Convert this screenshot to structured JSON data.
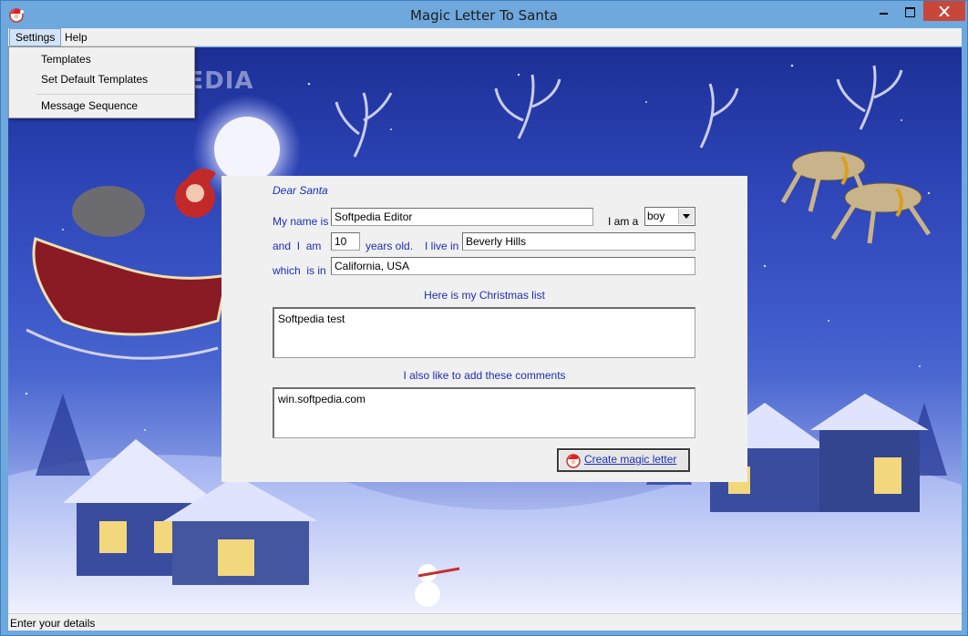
{
  "window": {
    "title": "Magic Letter To Santa",
    "accent": "#6ea8dd",
    "close_color": "#c9473a"
  },
  "menubar": {
    "items": [
      {
        "label": "Settings"
      },
      {
        "label": "Help"
      }
    ]
  },
  "settings_menu": {
    "items": [
      {
        "label": "Templates"
      },
      {
        "label": "Set Default Templates"
      },
      {
        "label": "Message Sequence"
      }
    ]
  },
  "watermark": "SOFTPEDIA",
  "letter": {
    "greeting": "Dear Santa",
    "name_label": "My name is",
    "name_value": "Softpedia Editor",
    "gender_label": "I am a",
    "gender_value": "boy",
    "age_prefix": "and  I  am",
    "age_value": "10",
    "age_suffix": "years old.",
    "live_label": "I live in",
    "city_value": "Beverly Hills",
    "which_label": "which  is in",
    "state_value": "California, USA",
    "list_heading": "Here is my Christmas list",
    "list_value": "Softpedia test",
    "comments_heading": "I also like to add these comments",
    "comments_value": "win.softpedia.com",
    "create_button": "Create magic letter",
    "text_color": "#1c2fb2"
  },
  "statusbar": {
    "text": "Enter your details"
  }
}
